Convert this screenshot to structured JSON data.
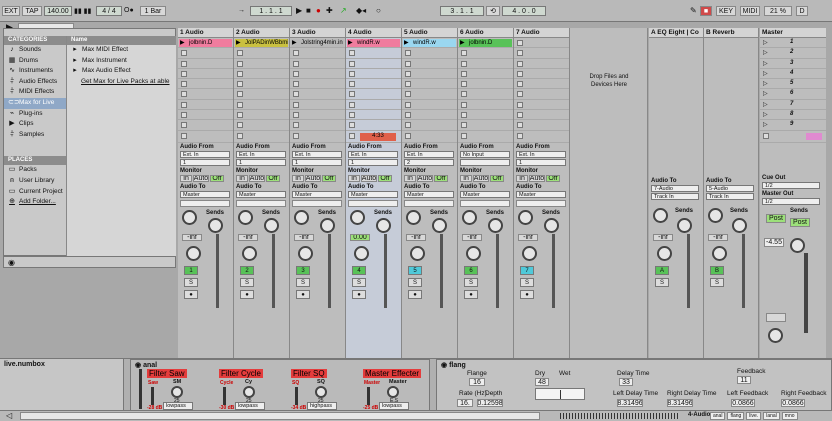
{
  "topbar": {
    "ext": "EXT",
    "tap": "TAP",
    "tempo": "140.00",
    "meter": "4 / 4",
    "quant": "1 Bar",
    "position": "1 . 1 . 1",
    "loop_start": "3 . 1 . 1",
    "loop_len": "4 . 0 . 0",
    "key": "KEY",
    "midi": "MIDI",
    "cpu": "21 %",
    "d": "D"
  },
  "browser": {
    "cat_header": "CATEGORIES",
    "name_header": "Name",
    "categories": [
      "Sounds",
      "Drums",
      "Instruments",
      "Audio Effects",
      "MIDI Effects",
      "Max for Live",
      "Plug-ins",
      "Clips",
      "Samples"
    ],
    "items": [
      "Max MIDI Effect",
      "Max Instrument",
      "Max Audio Effect"
    ],
    "hint": "Get Max for Live Packs at able",
    "places_header": "PLACES",
    "places": [
      "Packs",
      "User Library",
      "Current Project",
      "Add Folder..."
    ]
  },
  "tracks": [
    {
      "name": "1 Audio",
      "clip": "jolbnin.D",
      "clip_color": "#f07c9e",
      "from": "Ext. In",
      "ch": "1",
      "to": "Master",
      "num": "1",
      "col": "#58c258"
    },
    {
      "name": "2 Audio",
      "clip": "JolPADinWBbmin",
      "clip_color": "#c9c040",
      "from": "Ext. In",
      "ch": "1",
      "to": "Master",
      "num": "2",
      "col": "#58c258"
    },
    {
      "name": "3 Audio",
      "clip": "Jolstring4min.in",
      "clip_color": "#b8b8b8",
      "from": "Ext. In",
      "ch": "1",
      "to": "Master",
      "num": "3",
      "col": "#58c258"
    },
    {
      "name": "4 Audio",
      "clip": "windR.w",
      "clip_color": "#f07c9e",
      "from": "Ext. In",
      "ch": "1",
      "to": "Master",
      "num": "4",
      "col": "#58c258",
      "timer": "4:33",
      "vol": "0.00"
    },
    {
      "name": "5 Audio",
      "clip": "windR.w",
      "clip_color": "#9ad7f0",
      "from": "Ext. In",
      "ch": "2",
      "to": "Master",
      "num": "5",
      "col": "#4fc9d9"
    },
    {
      "name": "6 Audio",
      "clip": "jolbnin.D",
      "clip_color": "#58c258",
      "from": "No Input",
      "ch": "",
      "to": "Master",
      "num": "6",
      "col": "#58c258"
    },
    {
      "name": "7 Audio",
      "clip": "",
      "clip_color": "",
      "from": "Ext. In",
      "ch": "1",
      "to": "Master",
      "num": "7",
      "col": "#4fc9d9"
    }
  ],
  "drop_text": "Drop Files and Devices Here",
  "returns": [
    {
      "name": "A EQ Eight | Co",
      "to": "7-Audio",
      "sub": "Track In",
      "letter": "A"
    },
    {
      "name": "B Reverb",
      "to": "5-Audio",
      "sub": "Track In",
      "letter": "B"
    }
  ],
  "master": {
    "name": "Master",
    "cue": "Cue Out",
    "cue_val": "1/2",
    "out": "Master Out",
    "out_val": "1/2",
    "vol": "-4.55",
    "post": "Post",
    "scenes": [
      "1",
      "2",
      "3",
      "4",
      "5",
      "6",
      "7",
      "8",
      "9"
    ]
  },
  "labels": {
    "audio_from": "Audio From",
    "monitor": "Monitor",
    "audio_to": "Audio To",
    "in": "In",
    "auto": "Auto",
    "off": "Off",
    "sends": "Sends",
    "inf": "-inf",
    "s": "S"
  },
  "devices": {
    "numbox": "live.numbox",
    "anal": "anal",
    "sections": [
      {
        "title": "Filter Saw",
        "label": "Saw",
        "knob": "SM",
        "val": "25",
        "mode": "lowpass",
        "db": "-28 dB"
      },
      {
        "title": "Filter Cycle",
        "label": "Cycle",
        "knob": "Cy",
        "val": "25",
        "mode": "lowpass",
        "db": "-30 dB"
      },
      {
        "title": "Filter SQ",
        "label": "SQ",
        "knob": "SQ",
        "val": "25",
        "mode": "highpass",
        "db": "-34 dB"
      },
      {
        "title": "Master Effecter",
        "label": "Master",
        "knob": "Master",
        "val": "E.S",
        "val2": "17",
        "mode": "lowpass",
        "db": "-25 dB"
      }
    ],
    "flang": "flang",
    "flange": "Flange",
    "flange_val": "16",
    "dry": "Dry",
    "dry_val": "48",
    "wet": "Wet",
    "rate": "Rate (Hz)",
    "depth": "Depth",
    "rate_val": "16.",
    "depth_val": "0.12598",
    "delay": "Delay Time",
    "delay_val": "33",
    "ldt": "Left Delay Time",
    "rdt": "Right Delay Time",
    "ldt_val": "8.31496",
    "rdt_val": "8.31496",
    "feedback": "Feedback",
    "fb_val": "11",
    "lfb": "Left Feedback",
    "rfb": "Right Feedback",
    "lfb_val": "0.0866",
    "rfb_val": "0.0866"
  },
  "statusbar": {
    "track": "4-Audio",
    "items": [
      "anal",
      "flang",
      "live.",
      "lanal",
      "mno"
    ]
  }
}
